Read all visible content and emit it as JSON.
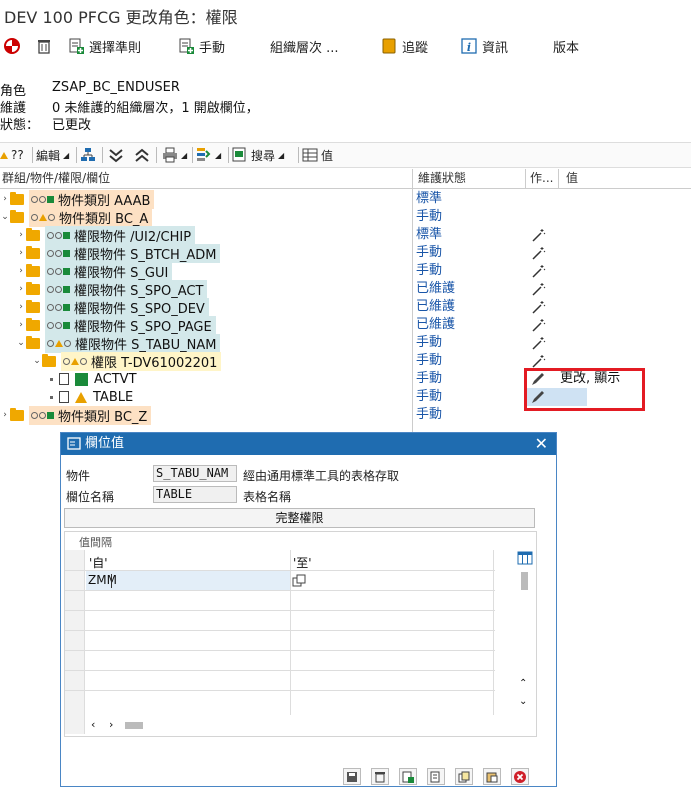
{
  "title": "DEV 100 PFCG 更改角色：權限",
  "toolbar1": {
    "select_criteria": "選擇準則",
    "manual": "手動",
    "org_levels": "組織層次 ...",
    "trace": "追蹤",
    "info": "資訊",
    "version": "版本"
  },
  "header": {
    "role_label": "角色",
    "role_value": "ZSAP_BC_ENDUSER",
    "maint_label": "維護",
    "maint_value": "0 未維護的組織層次，1 開啟欄位，",
    "status_label": "狀態：",
    "status_value": "已更改"
  },
  "toolbar2": {
    "q": "??",
    "edit": "編輯",
    "search": "搜尋",
    "value": "值"
  },
  "grid": {
    "col_tree": "群組/物件/權限/欄位",
    "col_status": "維護狀態",
    "col_action": "作...",
    "col_value": "值",
    "rows": [
      {
        "text": "物件類別 AAAB",
        "status": "標準"
      },
      {
        "text": "物件類別 BC_A",
        "status": "手動"
      },
      {
        "text": "權限物件 /UI2/CHIP",
        "status": "標準"
      },
      {
        "text": "權限物件 S_BTCH_ADM",
        "status": "手動"
      },
      {
        "text": "權限物件 S_GUI",
        "status": "手動"
      },
      {
        "text": "權限物件 S_SPO_ACT",
        "status": "已維護"
      },
      {
        "text": "權限物件 S_SPO_DEV",
        "status": "已維護"
      },
      {
        "text": "權限物件 S_SPO_PAGE",
        "status": "已維護"
      },
      {
        "text": "權限物件 S_TABU_NAM",
        "status": "手動"
      },
      {
        "text": "權限 T-DV61002201",
        "status": "手動"
      },
      {
        "text": "ACTVT",
        "status": "手動",
        "value": "更改, 顯示"
      },
      {
        "text": "TABLE",
        "status": "手動"
      },
      {
        "text": "物件類別 BC_Z",
        "status": "手動"
      }
    ]
  },
  "dialog": {
    "title": "欄位值",
    "object_label": "物件",
    "object_value": "S_TABU_NAM",
    "object_desc": "經由通用標準工具的表格存取",
    "field_label": "欄位名稱",
    "field_value": "TABLE",
    "field_desc": "表格名稱",
    "full_auth": "完整權限",
    "interval_label": "值間隔",
    "col_from": "'自'",
    "col_to": "'至'",
    "from_value": "ZMM"
  },
  "colors": {
    "dialog_header": "#1f6cb0",
    "highlight_box": "#e31b23",
    "status_text": "#1a56a8"
  }
}
